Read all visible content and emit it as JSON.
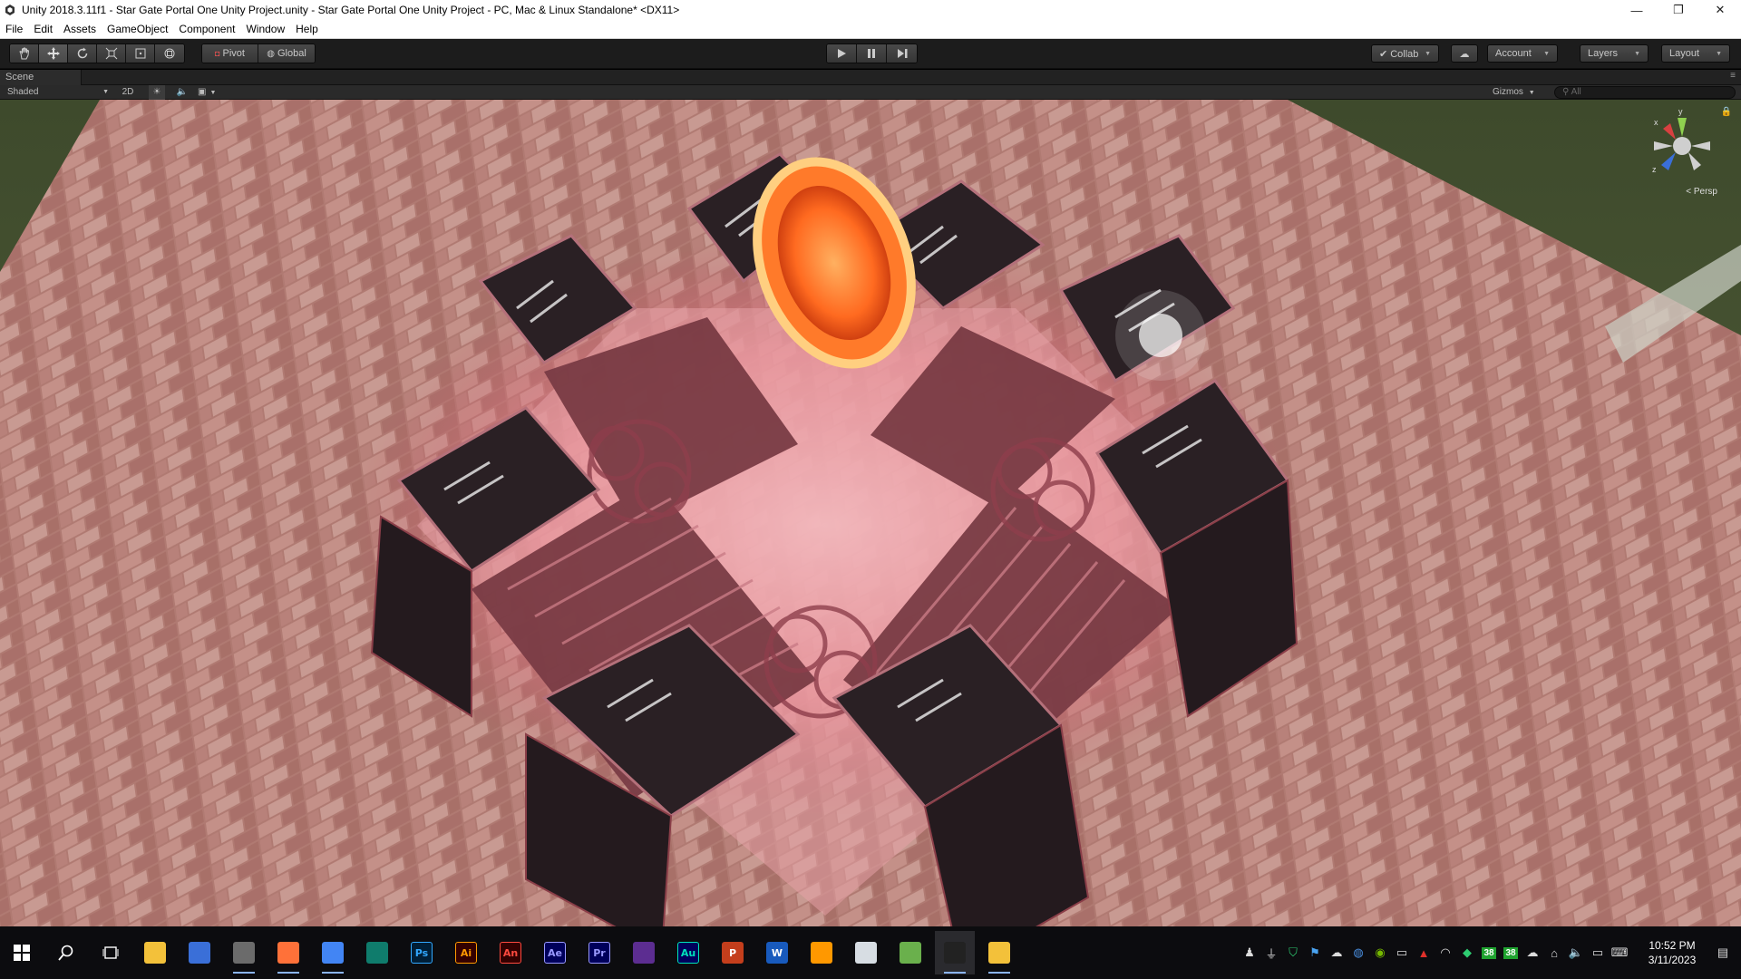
{
  "window": {
    "title": "Unity 2018.3.11f1 - Star Gate Portal One Unity Project.unity - Star Gate Portal One Unity Project - PC, Mac & Linux Standalone* <DX11>",
    "minimize_glyph": "—",
    "maximize_glyph": "❐",
    "close_glyph": "✕"
  },
  "menu": {
    "items": [
      "File",
      "Edit",
      "Assets",
      "GameObject",
      "Component",
      "Window",
      "Help"
    ]
  },
  "toolbar": {
    "tools": [
      "hand-tool",
      "move-tool",
      "rotate-tool",
      "scale-tool",
      "rect-tool",
      "transform-tool"
    ],
    "pivot_label": "Pivot",
    "global_label": "Global",
    "collab_label": "Collab",
    "account_label": "Account",
    "layers_label": "Layers",
    "layout_label": "Layout"
  },
  "scene": {
    "tab_label": "Scene",
    "shading_mode": "Shaded",
    "two_d_label": "2D",
    "gizmos_label": "Gizmos",
    "search_placeholder": "All",
    "gizmo_axes": {
      "x": "x",
      "y": "y",
      "z": "z"
    },
    "projection_label": "< Persp"
  },
  "taskbar": {
    "apps": [
      {
        "name": "file-explorer",
        "label": "",
        "color": "#f3c13a",
        "running": false
      },
      {
        "name": "unity-hub",
        "label": "",
        "color": "#3a6fd8",
        "running": false
      },
      {
        "name": "inkscape",
        "label": "",
        "color": "#6b6b6b",
        "running": true
      },
      {
        "name": "firefox",
        "label": "",
        "color": "#ff7139",
        "running": true
      },
      {
        "name": "chrome",
        "label": "",
        "color": "#4285f4",
        "running": true
      },
      {
        "name": "dreamweaver-doc",
        "label": "",
        "color": "#0f7c6c",
        "running": false
      },
      {
        "name": "photoshop",
        "label": "Ps",
        "color": "#001e36",
        "fg": "#31a8ff",
        "running": false
      },
      {
        "name": "illustrator",
        "label": "Ai",
        "color": "#330000",
        "fg": "#ff9a00",
        "running": false
      },
      {
        "name": "animate",
        "label": "An",
        "color": "#330000",
        "fg": "#ff4a3f",
        "running": false
      },
      {
        "name": "after-effects",
        "label": "Ae",
        "color": "#00005b",
        "fg": "#9999ff",
        "running": false
      },
      {
        "name": "premiere",
        "label": "Pr",
        "color": "#00005b",
        "fg": "#9999ff",
        "running": false
      },
      {
        "name": "visual-studio",
        "label": "",
        "color": "#5c2d91",
        "running": false
      },
      {
        "name": "audition",
        "label": "Au",
        "color": "#00005b",
        "fg": "#00e4bb",
        "running": false
      },
      {
        "name": "powerpoint",
        "label": "P",
        "color": "#c43e1c",
        "running": false
      },
      {
        "name": "word",
        "label": "W",
        "color": "#185abd",
        "running": false
      },
      {
        "name": "sublime",
        "label": "",
        "color": "#ff9800",
        "running": false
      },
      {
        "name": "notepad",
        "label": "",
        "color": "#d7dde3",
        "running": false
      },
      {
        "name": "installer",
        "label": "",
        "color": "#6ab04c",
        "running": false
      },
      {
        "name": "unity",
        "label": "",
        "color": "#222222",
        "running": true,
        "active": true
      },
      {
        "name": "folder",
        "label": "",
        "color": "#f3c13a",
        "running": true
      }
    ],
    "tray": {
      "badge_a": "38",
      "badge_b": "38",
      "time": "10:52 PM",
      "date": "3/11/2023"
    }
  }
}
